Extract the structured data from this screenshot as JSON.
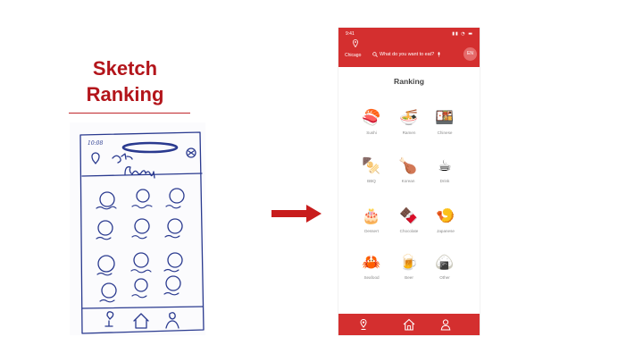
{
  "slide": {
    "sketch_label_line1": "Sketch",
    "sketch_label_line2": "Ranking"
  },
  "colors": {
    "accent": "#b3151b",
    "app_red": "#d42f2f",
    "sketch_ink": "#2a3a8f"
  },
  "sketch": {
    "time": "10:08",
    "heading": "Ranking"
  },
  "phone": {
    "status_time": "9:41",
    "location": "Chicago",
    "search_placeholder": "What do you want to eat?",
    "language": "EN",
    "title": "Ranking",
    "categories": [
      {
        "label": "Sushi",
        "emoji": "🍣"
      },
      {
        "label": "Ramen",
        "emoji": "🍜"
      },
      {
        "label": "Chinese",
        "emoji": "🍱"
      },
      {
        "label": "BBQ",
        "emoji": "🍢"
      },
      {
        "label": "Korean",
        "emoji": "🍗"
      },
      {
        "label": "Drink",
        "emoji": "☕"
      },
      {
        "label": "Dessert",
        "emoji": "🎂"
      },
      {
        "label": "Chocolate",
        "emoji": "🍫"
      },
      {
        "label": "Japanese",
        "emoji": "🍤"
      },
      {
        "label": "Seafood",
        "emoji": "🦀"
      },
      {
        "label": "Beer",
        "emoji": "🍺"
      },
      {
        "label": "Other",
        "emoji": "🍙"
      }
    ],
    "tabs": [
      "location-tab",
      "home-tab",
      "profile-tab"
    ]
  }
}
